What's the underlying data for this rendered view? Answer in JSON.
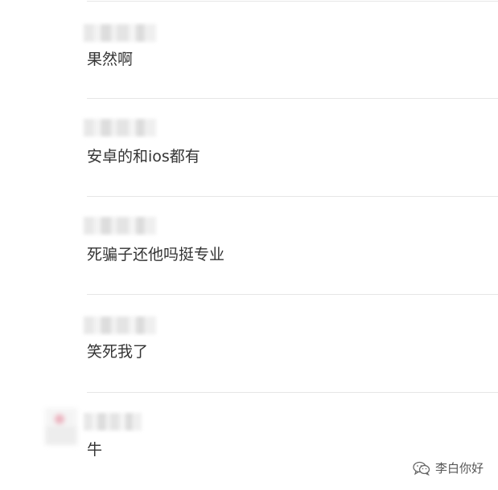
{
  "comments": [
    {
      "text": "果然啊"
    },
    {
      "text": "安卓的和ios都有"
    },
    {
      "text": "死骗子还他吗挺专业"
    },
    {
      "text": "笑死我了"
    },
    {
      "text": "牛"
    }
  ],
  "watermark": {
    "label": "李白你好",
    "icon": "wechat-icon"
  }
}
